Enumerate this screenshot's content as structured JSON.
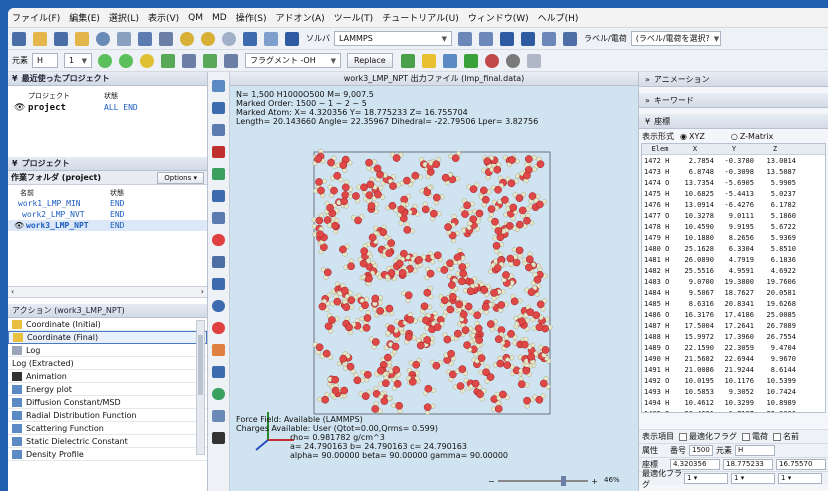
{
  "menu": [
    "ファイル(F)",
    "編集(E)",
    "選択(L)",
    "表示(V)",
    "QM",
    "MD",
    "操作(S)",
    "アドオン(A)",
    "ツール(T)",
    "チュートリアル(U)",
    "ウィンドウ(W)",
    "ヘルプ(H)"
  ],
  "toolbar": {
    "solver_label": "ソルバ",
    "solver_value": "LAMMPS",
    "label_field_label": "ラベル/電荷",
    "label_field_value": "(ラベル/電荷を選択?"
  },
  "toolbar2": {
    "element_label": "元素",
    "element_value": "H",
    "num_value": "1",
    "molecule_label": "フラグメント -OH",
    "replace_label": "Replace"
  },
  "recent": {
    "header": "最近使ったプロジェクト",
    "col_project": "プロジェクト",
    "col_status": "状態",
    "name": "project",
    "status": "ALL END"
  },
  "projects": {
    "header": "プロジェクト",
    "folder": "作業フォルダ (project)",
    "options": "Options ▾",
    "col_name": "名前",
    "col_status": "状態",
    "rows": [
      {
        "name": "work1_LMP_MIN",
        "status": "END"
      },
      {
        "name": "work2_LMP_NVT",
        "status": "END"
      },
      {
        "name": "work3_LMP_NPT",
        "status": "END"
      }
    ]
  },
  "analysis": {
    "header": "アクション (work3_LMP_NPT)",
    "items": [
      "Coordinate (Initial)",
      "Coordinate (Final)",
      "Log",
      "Log (Extracted)",
      "Animation",
      "Energy plot",
      "Diffusion Constant/MSD",
      "Radial Distribution Function",
      "Scattering Function",
      "Static Dielectric Constant",
      "Density Profile"
    ]
  },
  "view": {
    "title": "work3_LMP_NPT 出力ファイル (lmp_final.data)",
    "info": [
      "N= 1,500  H1000O500  M= 9,007.5",
      "Marked Order: 1500 ~ 1 ~ 2 ~ 5",
      "Marked Atom: X= 4.320356 Y= 18.775233 Z= 16.755704",
      "Length= 20.143660 Angle= 22.35967 Dihedral= -22.79506 Lper= 3.82756"
    ],
    "bottom": [
      "Force Field: Available (LAMMPS)",
      "Charges Available: User (Qtot=0.00,Qrms= 0.599)",
      "rho= 0.981782 g/cm^3",
      "a= 24.790163 b= 24.790163 c= 24.790163",
      "alpha= 90.00000 beta= 90.00000 gamma= 90.00000"
    ],
    "zoom": "46%"
  },
  "right": {
    "animation": "アニメーション",
    "keyword": "キーワード",
    "coords": "座標",
    "format_label": "表示形式",
    "opt_xyz": "XYZ",
    "opt_zmatrix": "Z-Matrix",
    "col_elem": "Elem",
    "col_x": "X",
    "col_y": "Y",
    "col_z": "Z",
    "rows": [
      [
        "1472 H",
        "2.7854",
        "-0.3780",
        "13.0814"
      ],
      [
        "1473 H",
        "6.8748",
        "-0.3098",
        "13.5087"
      ],
      [
        "1474 O",
        "13.7354",
        "-5.6905",
        "5.9905"
      ],
      [
        "1475 H",
        "10.6825",
        "-5.4413",
        "5.0237"
      ],
      [
        "1476 H",
        "13.0914",
        "-6.4276",
        "6.1782"
      ],
      [
        "1477 O",
        "10.3278",
        "9.0111",
        "5.1860"
      ],
      [
        "1478 H",
        "10.4590",
        "9.9195",
        "5.6722"
      ],
      [
        "1479 H",
        "10.1880",
        "8.2656",
        "5.9369"
      ],
      [
        "1480 O",
        "25.1628",
        "6.3304",
        "5.8510"
      ],
      [
        "1481 H",
        "26.0890",
        "4.7919",
        "6.1836"
      ],
      [
        "1482 H",
        "25.5516",
        "4.9591",
        "4.6922"
      ],
      [
        "1483 O",
        "9.0700",
        "19.3800",
        "19.7606"
      ],
      [
        "1484 H",
        "9.5067",
        "18.7627",
        "20.0581"
      ],
      [
        "1485 H",
        "8.6316",
        "20.8341",
        "19.6268"
      ],
      [
        "1486 O",
        "16.3176",
        "17.4186",
        "25.0085"
      ],
      [
        "1487 H",
        "17.5004",
        "17.2641",
        "26.7089"
      ],
      [
        "1488 H",
        "15.9972",
        "17.3960",
        "26.7554"
      ],
      [
        "1489 O",
        "22.1590",
        "22.3059",
        "9.4704"
      ],
      [
        "1490 H",
        "21.5602",
        "22.6944",
        "9.9670"
      ],
      [
        "1491 H",
        "21.0086",
        "21.9244",
        "8.6144"
      ],
      [
        "1492 O",
        "10.0195",
        "10.1176",
        "10.5399"
      ],
      [
        "1493 H",
        "10.5853",
        "9.3052",
        "10.7424"
      ],
      [
        "1494 H",
        "10.4612",
        "10.3299",
        "10.8989"
      ],
      [
        "1495 O",
        "28.4621",
        "1.7137",
        "22.0886"
      ],
      [
        "1496 H",
        "28.0130",
        "2.5486",
        "21.5423"
      ],
      [
        "1497 H",
        "28.6067",
        "0.7785",
        "21.7669"
      ],
      [
        "1498 O",
        "5.0397",
        "19.4609",
        "16.6656"
      ],
      [
        "1499 H",
        "5.6256",
        "19.2284",
        "17.1743"
      ],
      [
        "1500 H",
        "4.3204",
        "18.7752",
        "16.7557"
      ]
    ],
    "item_label": "表示項目",
    "chk1": "最適化フラグ",
    "chk2": "電荷",
    "chk3": "名前",
    "attr_label": "属性",
    "num_label": "番号",
    "num_value": "1500",
    "elem_label": "元素",
    "elem_value": "H",
    "coord_label": "座標",
    "cx": "4.320356",
    "cy": "18.775233",
    "cz": "16.75570",
    "opt_label": "最適化フラグ",
    "opt1": "1",
    "opt2": "1",
    "opt3": "1"
  }
}
